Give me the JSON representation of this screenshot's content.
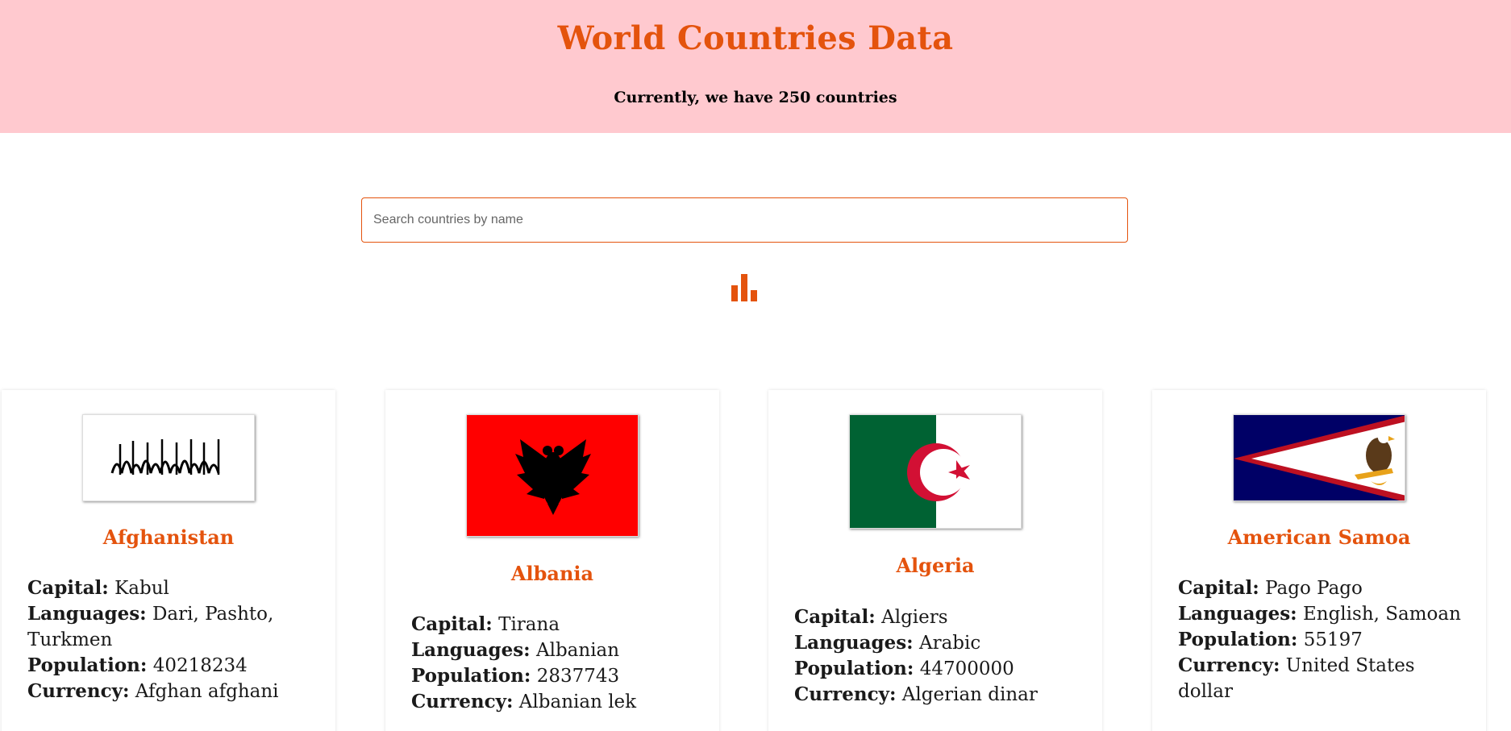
{
  "header": {
    "title": "World Countries Data",
    "subtitle": "Currently, we have 250 countries"
  },
  "search": {
    "placeholder": "Search countries by name",
    "value": ""
  },
  "graph_button": {
    "icon": "bar-chart-icon"
  },
  "labels": {
    "capital": "Capital:",
    "languages": "Languages:",
    "population": "Population:",
    "currency": "Currency:"
  },
  "countries": [
    {
      "name": "Afghanistan",
      "capital": "Kabul",
      "languages": "Dari, Pashto, Turkmen",
      "population": "40218234",
      "currency": "Afghan afghani",
      "flag": "afghanistan-flag-icon"
    },
    {
      "name": "Albania",
      "capital": "Tirana",
      "languages": "Albanian",
      "population": "2837743",
      "currency": "Albanian lek",
      "flag": "albania-flag-icon"
    },
    {
      "name": "Algeria",
      "capital": "Algiers",
      "languages": "Arabic",
      "population": "44700000",
      "currency": "Algerian dinar",
      "flag": "algeria-flag-icon"
    },
    {
      "name": "American Samoa",
      "capital": "Pago Pago",
      "languages": "English, Samoan",
      "population": "55197",
      "currency": "United States dollar",
      "flag": "american-samoa-flag-icon"
    }
  ],
  "colors": {
    "accent": "#e4530d",
    "header_bg": "#ffc9cf"
  }
}
